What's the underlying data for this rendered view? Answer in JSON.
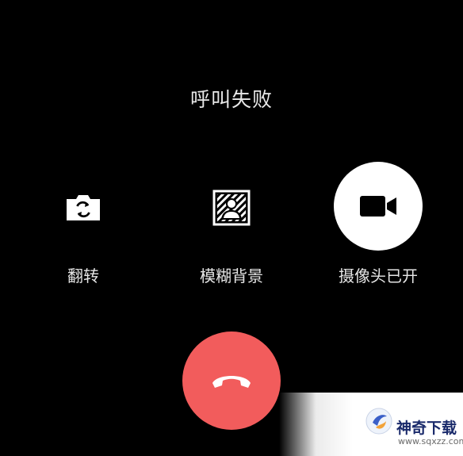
{
  "call": {
    "status": "呼叫失败"
  },
  "controls": {
    "flip": {
      "label": "翻转",
      "icon": "camera-flip-icon"
    },
    "blur_background": {
      "label": "模糊背景",
      "icon": "blur-background-icon"
    },
    "camera": {
      "label": "摄像头已开",
      "icon": "video-camera-icon"
    }
  },
  "hangup": {
    "icon": "phone-hangup-icon"
  },
  "watermark": {
    "title": "神奇下载",
    "url": "www.sqxzz.com"
  },
  "colors": {
    "background": "#000000",
    "hangup": "#f25c5c",
    "camera_active": "#ffffff",
    "text": "#e6e6e6"
  }
}
